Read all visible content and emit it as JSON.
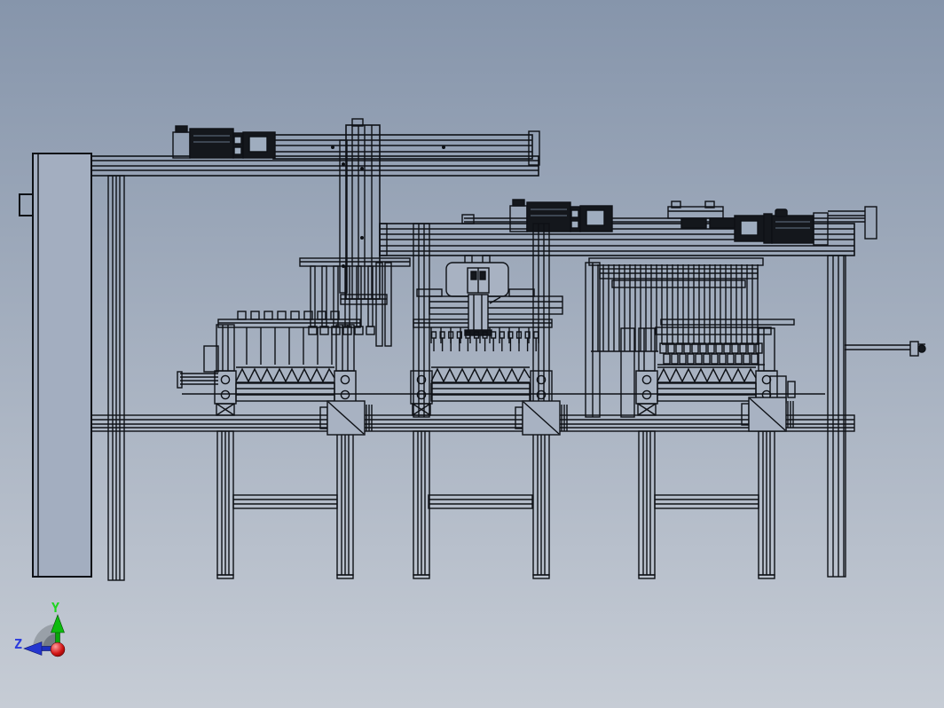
{
  "viewport": {
    "background_top_color": "#8695ab",
    "background_bottom_color": "#c6ccd5",
    "wireframe_color": "#0e1116"
  },
  "machine": {
    "stations": [
      "left-station",
      "middle-station",
      "right-station"
    ]
  },
  "triad": {
    "y_axis": {
      "label": "Y",
      "color": "#1fd51f"
    },
    "z_axis": {
      "label": "Z",
      "color": "#2b3bdc"
    },
    "x_axis": {
      "color": "#c01212"
    }
  }
}
